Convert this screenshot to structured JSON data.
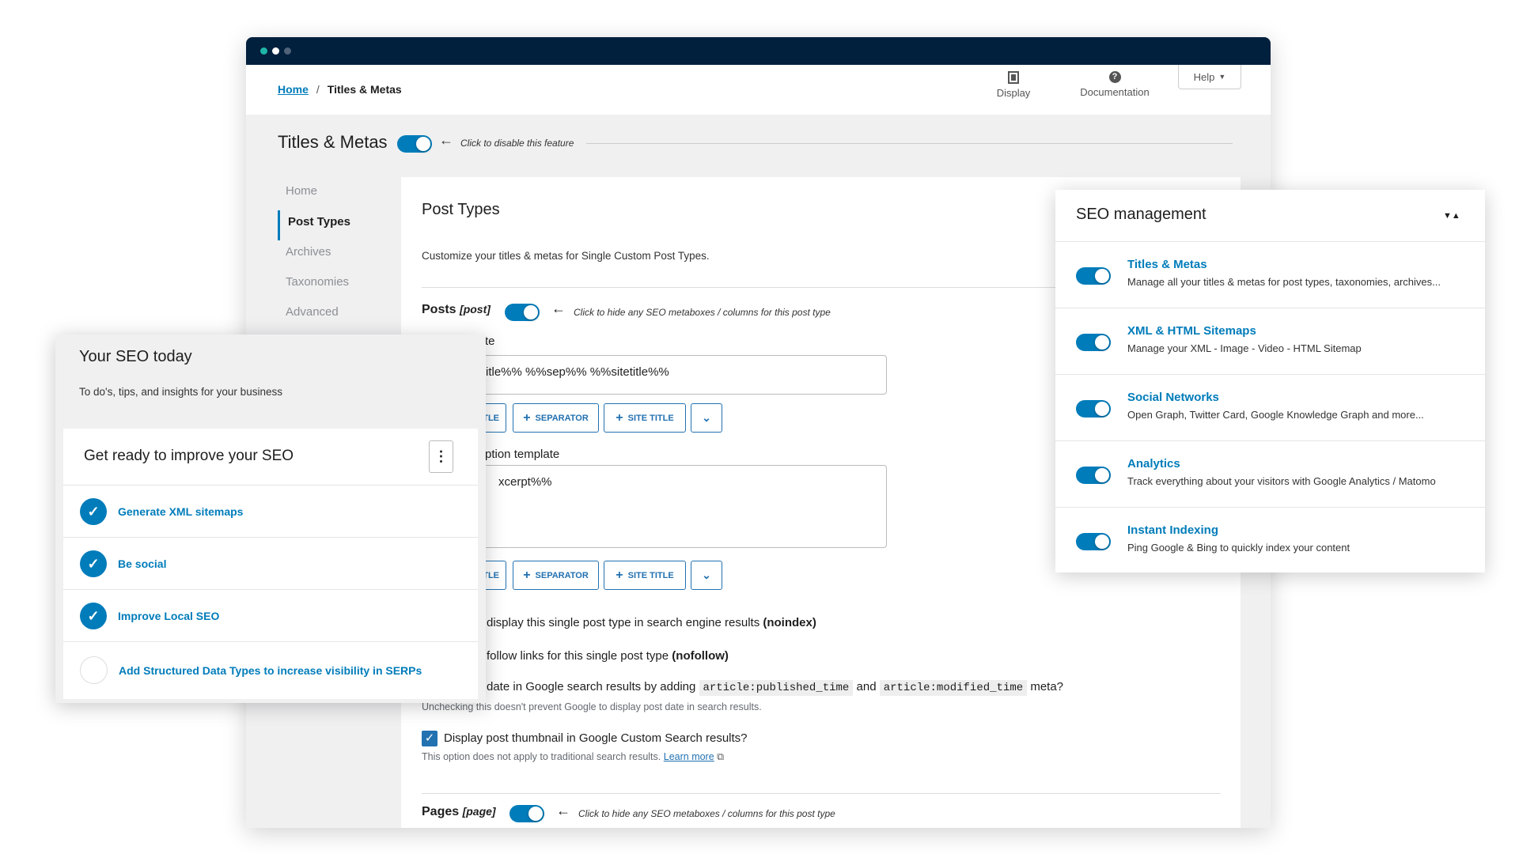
{
  "window": {
    "dots": [
      "#1fb6a6",
      "#ffffff",
      "#50627a"
    ]
  },
  "header": {
    "breadcrumb": {
      "home": "Home",
      "separator": "/",
      "current": "Titles & Metas"
    },
    "display_label": "Display",
    "documentation_label": "Documentation",
    "help_label": "Help"
  },
  "feature": {
    "title": "Titles & Metas",
    "toggle_on": true,
    "hint": "Click to disable this feature"
  },
  "sidebar": {
    "items": [
      {
        "label": "Home"
      },
      {
        "label": "Post Types",
        "active": true
      },
      {
        "label": "Archives"
      },
      {
        "label": "Taxonomies"
      },
      {
        "label": "Advanced"
      }
    ]
  },
  "main": {
    "title": "Post Types",
    "description": "Customize your titles & metas for Single Custom Post Types.",
    "posts": {
      "name": "Posts",
      "slug": "[post]",
      "toggle_on": true,
      "hint": "Click to hide any SEO metaboxes / columns for this post type"
    },
    "title_template": {
      "label": "te",
      "value": "itle%% %%sep%% %%sitetitle%%"
    },
    "buttons": {
      "partial": "TLE",
      "separator": "SEPARATOR",
      "site_title": "SITE TITLE"
    },
    "desc_template": {
      "label": "ption template",
      "value": "xcerpt%%"
    },
    "noindex": {
      "text": "display this single post type in search engine results ",
      "bold": "(noindex)"
    },
    "nofollow": {
      "text": "follow links for this single post type ",
      "bold": "(nofollow)"
    },
    "date": {
      "text1": "date in Google search results by adding ",
      "code1": "article:published_time",
      "and": " and ",
      "code2": "article:modified_time",
      "text2": " meta?",
      "help": "Unchecking this doesn't prevent Google to display post date in search results."
    },
    "thumbnail": {
      "checked": true,
      "label": "Display post thumbnail in Google Custom Search results?",
      "help": "This option does not apply to traditional search results.",
      "learn_more": "Learn more"
    },
    "pages": {
      "name": "Pages",
      "slug": "[page]",
      "hint": "Click to hide any SEO metaboxes / columns for this post type"
    }
  },
  "seo_today": {
    "title": "Your SEO today",
    "subtitle": "To do's, tips, and insights for your business",
    "card_title": "Get ready to improve your SEO",
    "items": [
      {
        "label": "Generate XML sitemaps",
        "done": true
      },
      {
        "label": "Be social",
        "done": true
      },
      {
        "label": "Improve Local SEO",
        "done": true
      },
      {
        "label": "Add Structured Data Types to increase visibility in SERPs",
        "done": false
      }
    ]
  },
  "seo_management": {
    "title": "SEO management",
    "modules": [
      {
        "title": "Titles & Metas",
        "desc": "Manage all your titles & metas for post types, taxonomies, archives...",
        "on": true
      },
      {
        "title": "XML & HTML Sitemaps",
        "desc": "Manage your XML - Image - Video - HTML Sitemap",
        "on": true
      },
      {
        "title": "Social Networks",
        "desc": "Open Graph, Twitter Card, Google Knowledge Graph and more...",
        "on": true
      },
      {
        "title": "Analytics",
        "desc": "Track everything about your visitors with Google Analytics / Matomo",
        "on": true
      },
      {
        "title": "Instant Indexing",
        "desc": "Ping Google & Bing to quickly index your content",
        "on": true
      }
    ]
  },
  "colors": {
    "accent": "#007cba",
    "titlebar": "#00203d"
  }
}
